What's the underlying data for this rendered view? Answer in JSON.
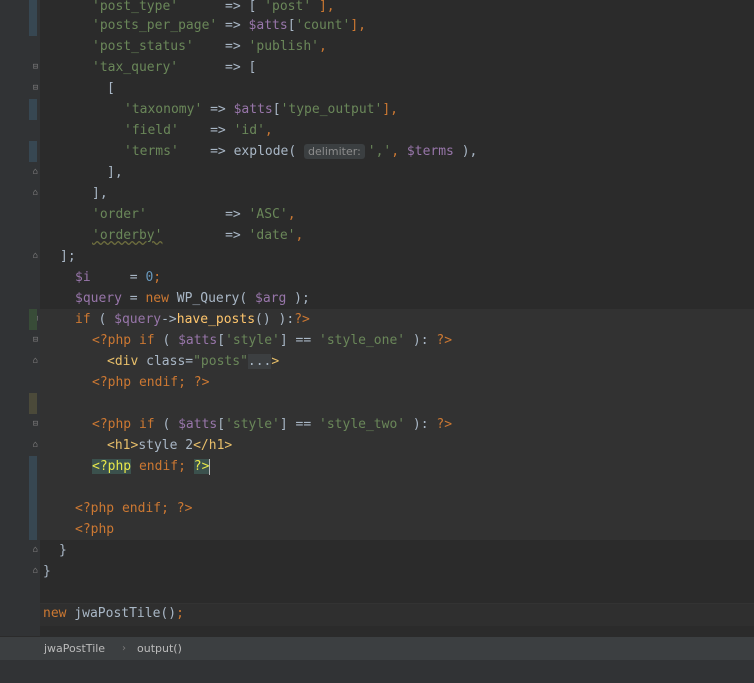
{
  "editor": {
    "lines": [
      {
        "id": "l1",
        "tokens": [
          {
            "t": "'post_type'",
            "c": "str"
          },
          {
            "t": "      => [ ",
            "c": "plain"
          },
          {
            "t": "'post'",
            "c": "str"
          },
          {
            "t": " ],",
            "c": "punc"
          }
        ]
      },
      {
        "id": "l2",
        "tokens": [
          {
            "t": "'posts_per_page'",
            "c": "str"
          },
          {
            "t": " => ",
            "c": "plain"
          },
          {
            "t": "$atts",
            "c": "var"
          },
          {
            "t": "[",
            "c": "plain"
          },
          {
            "t": "'count'",
            "c": "str"
          },
          {
            "t": "],",
            "c": "punc"
          }
        ]
      },
      {
        "id": "l3",
        "tokens": [
          {
            "t": "'post_status'",
            "c": "str"
          },
          {
            "t": "    => ",
            "c": "plain"
          },
          {
            "t": "'publish'",
            "c": "str"
          },
          {
            "t": ",",
            "c": "punc"
          }
        ]
      },
      {
        "id": "l4",
        "tokens": [
          {
            "t": "'tax_query'",
            "c": "str"
          },
          {
            "t": "      => [",
            "c": "plain"
          }
        ]
      },
      {
        "id": "l5",
        "tokens": [
          {
            "t": "[",
            "c": "plain"
          }
        ]
      },
      {
        "id": "l6",
        "tokens": [
          {
            "t": "'taxonomy'",
            "c": "str"
          },
          {
            "t": " => ",
            "c": "plain"
          },
          {
            "t": "$atts",
            "c": "var"
          },
          {
            "t": "[",
            "c": "plain"
          },
          {
            "t": "'type_output'",
            "c": "str"
          },
          {
            "t": "],",
            "c": "punc"
          }
        ]
      },
      {
        "id": "l7",
        "tokens": [
          {
            "t": "'field'",
            "c": "str"
          },
          {
            "t": "    => ",
            "c": "plain"
          },
          {
            "t": "'id'",
            "c": "str"
          },
          {
            "t": ",",
            "c": "punc"
          }
        ]
      },
      {
        "id": "l8",
        "tokens": [
          {
            "t": "'terms'",
            "c": "str"
          },
          {
            "t": "    => explode( ",
            "c": "plain"
          },
          {
            "t": "delimiter:",
            "c": "hint"
          },
          {
            "t": "','",
            "c": "str"
          },
          {
            "t": ", ",
            "c": "punc"
          },
          {
            "t": "$terms",
            "c": "var"
          },
          {
            "t": " ),",
            "c": "plain"
          }
        ]
      },
      {
        "id": "l9",
        "tokens": [
          {
            "t": "],",
            "c": "plain"
          }
        ]
      },
      {
        "id": "l10",
        "tokens": [
          {
            "t": "],",
            "c": "plain"
          }
        ]
      },
      {
        "id": "l11",
        "tokens": [
          {
            "t": "'order'",
            "c": "str"
          },
          {
            "t": "          => ",
            "c": "plain"
          },
          {
            "t": "'ASC'",
            "c": "str"
          },
          {
            "t": ",",
            "c": "punc"
          }
        ]
      },
      {
        "id": "l12",
        "tokens": [
          {
            "t": "'orderby'",
            "c": "str-ul"
          },
          {
            "t": "        => ",
            "c": "plain"
          },
          {
            "t": "'date'",
            "c": "str"
          },
          {
            "t": ",",
            "c": "punc"
          }
        ]
      },
      {
        "id": "l13",
        "tokens": [
          {
            "t": "];",
            "c": "plain"
          }
        ]
      },
      {
        "id": "l14",
        "tokens": [
          {
            "t": "$i",
            "c": "var"
          },
          {
            "t": "     = ",
            "c": "plain"
          },
          {
            "t": "0",
            "c": "num"
          },
          {
            "t": ";",
            "c": "punc"
          }
        ]
      },
      {
        "id": "l15",
        "tokens": [
          {
            "t": "$query",
            "c": "var"
          },
          {
            "t": " = ",
            "c": "plain"
          },
          {
            "t": "new",
            "c": "kw"
          },
          {
            "t": " WP_Query( ",
            "c": "plain"
          },
          {
            "t": "$arg",
            "c": "var"
          },
          {
            "t": " );",
            "c": "plain"
          }
        ]
      },
      {
        "id": "l16",
        "tokens": [
          {
            "t": "if",
            "c": "kw"
          },
          {
            "t": " ( ",
            "c": "plain"
          },
          {
            "t": "$query",
            "c": "var"
          },
          {
            "t": "->",
            "c": "plain"
          },
          {
            "t": "have_posts",
            "c": "fn"
          },
          {
            "t": "() ):",
            "c": "plain"
          },
          {
            "t": "?>",
            "c": "kw"
          }
        ]
      },
      {
        "id": "l17",
        "tokens": [
          {
            "t": "<?php",
            "c": "kw"
          },
          {
            "t": " if",
            "c": "kw"
          },
          {
            "t": " ( ",
            "c": "plain"
          },
          {
            "t": "$atts",
            "c": "var"
          },
          {
            "t": "[",
            "c": "plain"
          },
          {
            "t": "'style'",
            "c": "str"
          },
          {
            "t": "] == ",
            "c": "plain"
          },
          {
            "t": "'style_one'",
            "c": "str"
          },
          {
            "t": " ): ",
            "c": "plain"
          },
          {
            "t": "?>",
            "c": "kw"
          }
        ]
      },
      {
        "id": "l18",
        "tokens": [
          {
            "t": "<div ",
            "c": "tag"
          },
          {
            "t": "class",
            "c": "plain"
          },
          {
            "t": "=",
            "c": "plain"
          },
          {
            "t": "\"posts\"",
            "c": "str"
          },
          {
            "t": "...",
            "c": "folded"
          },
          {
            "t": ">",
            "c": "tag"
          }
        ]
      },
      {
        "id": "l19",
        "tokens": [
          {
            "t": "<?php",
            "c": "kw"
          },
          {
            "t": " endif",
            "c": "kw"
          },
          {
            "t": "; ",
            "c": "punc"
          },
          {
            "t": "?>",
            "c": "kw"
          }
        ]
      },
      {
        "id": "l20",
        "tokens": []
      },
      {
        "id": "l21",
        "tokens": [
          {
            "t": "<?php",
            "c": "kw"
          },
          {
            "t": " if",
            "c": "kw"
          },
          {
            "t": " ( ",
            "c": "plain"
          },
          {
            "t": "$atts",
            "c": "var"
          },
          {
            "t": "[",
            "c": "plain"
          },
          {
            "t": "'style'",
            "c": "str"
          },
          {
            "t": "] == ",
            "c": "plain"
          },
          {
            "t": "'style_two'",
            "c": "str"
          },
          {
            "t": " ): ",
            "c": "plain"
          },
          {
            "t": "?>",
            "c": "kw"
          }
        ]
      },
      {
        "id": "l22",
        "tokens": [
          {
            "t": "<h1>",
            "c": "tag"
          },
          {
            "t": "style 2",
            "c": "plain"
          },
          {
            "t": "</h1>",
            "c": "tag"
          }
        ]
      },
      {
        "id": "l23",
        "tokens": [
          {
            "t": "<?php",
            "c": "kw-hl"
          },
          {
            "t": " endif",
            "c": "kw"
          },
          {
            "t": "; ",
            "c": "punc"
          },
          {
            "t": "?>",
            "c": "kw-hl"
          }
        ]
      },
      {
        "id": "l24",
        "tokens": []
      },
      {
        "id": "l25",
        "tokens": [
          {
            "t": "<?php",
            "c": "kw"
          },
          {
            "t": " endif",
            "c": "kw"
          },
          {
            "t": "; ",
            "c": "punc"
          },
          {
            "t": "?>",
            "c": "kw"
          }
        ]
      },
      {
        "id": "l26",
        "tokens": [
          {
            "t": "<?php",
            "c": "kw"
          }
        ]
      },
      {
        "id": "l27",
        "tokens": [
          {
            "t": "}",
            "c": "plain"
          }
        ]
      },
      {
        "id": "l28",
        "tokens": [
          {
            "t": "}",
            "c": "plain"
          }
        ]
      },
      {
        "id": "l29",
        "tokens": []
      },
      {
        "id": "l30",
        "tokens": [
          {
            "t": "new",
            "c": "kw"
          },
          {
            "t": " jwaPostTile()",
            "c": "plain"
          },
          {
            "t": ";",
            "c": "punc"
          }
        ]
      }
    ]
  },
  "breadcrumb": {
    "class_name": "jwaPostTile",
    "separator": "›",
    "method_name": "output()"
  },
  "colors": {
    "background": "#2b2b2b",
    "string": "#6a8759",
    "keyword": "#cc7832",
    "variable": "#9876aa",
    "number": "#6897bb",
    "function": "#ffc66d"
  }
}
